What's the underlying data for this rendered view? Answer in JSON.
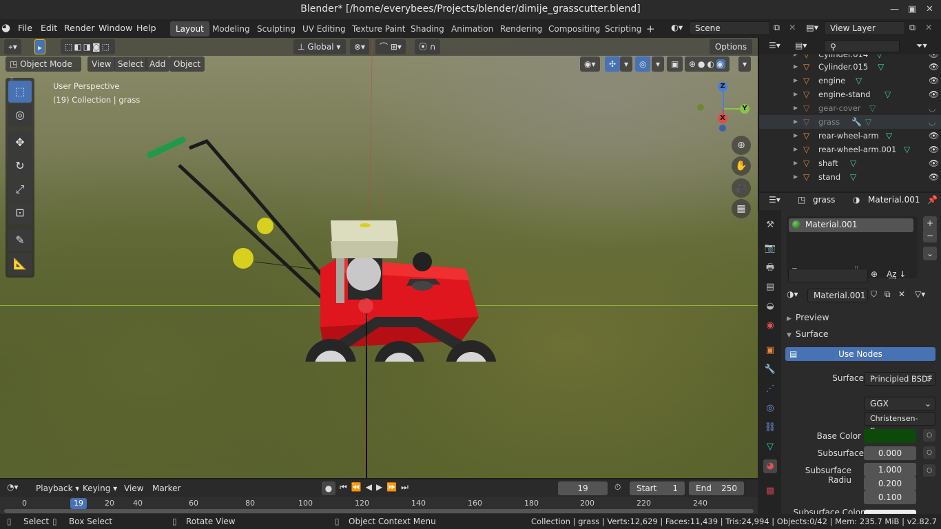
{
  "title": "Blender* [/home/everybees/Projects/blender/dimije_grasscutter.blend]",
  "menus": [
    "File",
    "Edit",
    "Render",
    "Window",
    "Help"
  ],
  "workspaces": [
    "Layout",
    "Modeling",
    "Sculpting",
    "UV Editing",
    "Texture Paint",
    "Shading",
    "Animation",
    "Rendering",
    "Compositing",
    "Scripting"
  ],
  "active_workspace": "Layout",
  "scene": "Scene",
  "view_layer": "View Layer",
  "header": {
    "transform_orientation": "Global",
    "options": "Options"
  },
  "viewport_header": {
    "mode": "Object Mode",
    "menus": [
      "View",
      "Select",
      "Add",
      "Object"
    ]
  },
  "overlay_text": {
    "perspective": "User Perspective",
    "collection": "(19) Collection | grass"
  },
  "gizmo": {
    "z": "Z",
    "y": "Y",
    "x": "X"
  },
  "outliner": {
    "search_placeholder": "",
    "rows": [
      {
        "name": "Cylinder.014",
        "dim": false
      },
      {
        "name": "Cylinder.015",
        "dim": false
      },
      {
        "name": "engine",
        "dim": false
      },
      {
        "name": "engine-stand",
        "dim": false
      },
      {
        "name": "gear-cover",
        "dim": true
      },
      {
        "name": "grass",
        "dim": true
      },
      {
        "name": "rear-wheel-arm",
        "dim": false
      },
      {
        "name": "rear-wheel-arm.001",
        "dim": false
      },
      {
        "name": "shaft",
        "dim": false
      },
      {
        "name": "stand",
        "dim": false
      }
    ]
  },
  "properties": {
    "object": "grass",
    "material_crumb": "Material.001",
    "slot": "Material.001",
    "material_name": "Material.001",
    "preview": "Preview",
    "surface_panel": "Surface",
    "use_nodes": "Use Nodes",
    "surface_label": "Surface",
    "surface_value": "Principled BSDF",
    "distribution": "GGX",
    "subsurface_method": "Christensen-Bur...",
    "base_color_label": "Base Color",
    "base_color": "#0d4a0a",
    "subsurface_label": "Subsurface",
    "subsurface": "0.000",
    "subsurface_radius_label": "Subsurface Radiu",
    "subsurface_radius": [
      "1.000",
      "0.200",
      "0.100"
    ],
    "subsurface_color_label": "Subsurface Color"
  },
  "timeline": {
    "menus": [
      "Playback",
      "Keying",
      "View",
      "Marker"
    ],
    "current_frame": "19",
    "start_label": "Start",
    "start": "1",
    "end_label": "End",
    "end": "250",
    "ruler": [
      "0",
      "20",
      "40",
      "60",
      "80",
      "100",
      "120",
      "140",
      "160",
      "180",
      "200",
      "220",
      "240"
    ],
    "playhead": "19"
  },
  "status": {
    "select": "Select",
    "box_select": "Box Select",
    "rotate_view": "Rotate View",
    "context_menu": "Object Context Menu",
    "stats": "Collection | grass | Verts:12,629 | Faces:11,439 | Tris:24,994 | Objects:0/42 | Mem: 235.7 MiB | v2.82.7"
  },
  "colors": {
    "accent": "#4772b3",
    "mesh": "#3ddaa2",
    "object": "#e8883a",
    "mower_red": "#e0161e"
  }
}
